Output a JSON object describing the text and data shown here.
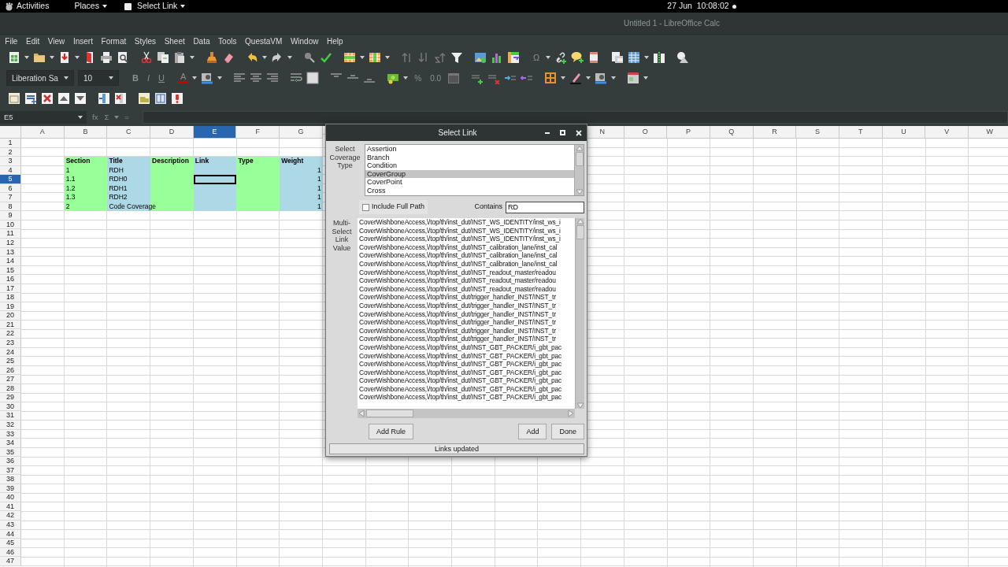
{
  "top_bar": {
    "activities": "Activities",
    "places": "Places",
    "app_menu": "Select Link",
    "clock": "27 Jun  10:08:02"
  },
  "window": {
    "title": "Untitled 1 - LibreOffice Calc"
  },
  "menu": [
    "File",
    "Edit",
    "View",
    "Insert",
    "Format",
    "Styles",
    "Sheet",
    "Data",
    "Tools",
    "QuestaVM",
    "Window",
    "Help"
  ],
  "toolbar": {
    "special_character": "Ω",
    "font_name": "Liberation Sa",
    "font_size": "10",
    "text_format_buttons": [
      "B",
      "I",
      "U"
    ],
    "font_color_button": "A",
    "number_format_buttons": [
      "%",
      "0.0"
    ]
  },
  "formula_bar": {
    "name_box": "E5",
    "function_buttons": [
      "fx",
      "Σ",
      "="
    ]
  },
  "sheet": {
    "columns": [
      {
        "label": "A",
        "selected": false
      },
      {
        "label": "B",
        "selected": false
      },
      {
        "label": "C",
        "selected": false
      },
      {
        "label": "D",
        "selected": false
      },
      {
        "label": "E",
        "selected": true
      },
      {
        "label": "F",
        "selected": false
      },
      {
        "label": "G",
        "selected": false
      },
      {
        "label": "N",
        "selected": false
      },
      {
        "label": "O",
        "selected": false
      },
      {
        "label": "P",
        "selected": false
      },
      {
        "label": "Q",
        "selected": false
      },
      {
        "label": "R",
        "selected": false
      },
      {
        "label": "S",
        "selected": false
      },
      {
        "label": "T",
        "selected": false
      },
      {
        "label": "U",
        "selected": false
      },
      {
        "label": "V",
        "selected": false
      },
      {
        "label": "W",
        "selected": false
      }
    ],
    "rows": [
      {
        "label": "1",
        "selected": false
      },
      {
        "label": "2",
        "selected": false
      },
      {
        "label": "3",
        "selected": false
      },
      {
        "label": "4",
        "selected": false
      },
      {
        "label": "5",
        "selected": true
      },
      {
        "label": "6",
        "selected": false
      },
      {
        "label": "7",
        "selected": false
      },
      {
        "label": "8",
        "selected": false
      },
      {
        "label": "9",
        "selected": false
      },
      {
        "label": "10",
        "selected": false
      },
      {
        "label": "11",
        "selected": false
      },
      {
        "label": "12",
        "selected": false
      },
      {
        "label": "13",
        "selected": false
      },
      {
        "label": "14",
        "selected": false
      },
      {
        "label": "15",
        "selected": false
      },
      {
        "label": "16",
        "selected": false
      },
      {
        "label": "17",
        "selected": false
      },
      {
        "label": "18",
        "selected": false
      },
      {
        "label": "19",
        "selected": false
      },
      {
        "label": "20",
        "selected": false
      },
      {
        "label": "21",
        "selected": false
      },
      {
        "label": "22",
        "selected": false
      },
      {
        "label": "23",
        "selected": false
      },
      {
        "label": "24",
        "selected": false
      },
      {
        "label": "25",
        "selected": false
      },
      {
        "label": "26",
        "selected": false
      },
      {
        "label": "27",
        "selected": false
      },
      {
        "label": "28",
        "selected": false
      },
      {
        "label": "29",
        "selected": false
      },
      {
        "label": "30",
        "selected": false
      },
      {
        "label": "31",
        "selected": false
      },
      {
        "label": "32",
        "selected": false
      },
      {
        "label": "33",
        "selected": false
      },
      {
        "label": "34",
        "selected": false
      },
      {
        "label": "35",
        "selected": false
      },
      {
        "label": "36",
        "selected": false
      },
      {
        "label": "37",
        "selected": false
      },
      {
        "label": "38",
        "selected": false
      },
      {
        "label": "39",
        "selected": false
      },
      {
        "label": "40",
        "selected": false
      },
      {
        "label": "41",
        "selected": false
      },
      {
        "label": "42",
        "selected": false
      },
      {
        "label": "43",
        "selected": false
      },
      {
        "label": "44",
        "selected": false
      },
      {
        "label": "45",
        "selected": false
      },
      {
        "label": "46",
        "selected": false
      },
      {
        "label": "47",
        "selected": false
      }
    ],
    "block": {
      "columns": [
        {
          "color": "#99ff99",
          "kind": "text",
          "cells": [
            "Section",
            "1",
            "1.1",
            "1.2",
            "1.3",
            "2"
          ]
        },
        {
          "color": "#add8e6",
          "kind": "text",
          "cells": [
            "Title",
            "RDH",
            "RDH0",
            "RDH1",
            "RDH2",
            "Code Coverage"
          ]
        },
        {
          "color": "#99ff99",
          "kind": "text",
          "cells": [
            "Description"
          ]
        },
        {
          "color": "#add8e6",
          "kind": "text",
          "cells": [
            "Link"
          ]
        },
        {
          "color": "#99ff99",
          "kind": "text",
          "cells": [
            "Type"
          ]
        },
        {
          "color": "#add8e6",
          "kind": "number",
          "cells": [
            "Weight",
            "1",
            "1",
            "1",
            "1",
            "1"
          ]
        }
      ]
    }
  },
  "dialog": {
    "title": "Select Link",
    "coverage_label": "Select Coverage Type",
    "coverage_types": [
      {
        "label": "Assertion",
        "selected": false
      },
      {
        "label": "Branch",
        "selected": false
      },
      {
        "label": "Condition",
        "selected": false
      },
      {
        "label": "CoverGroup",
        "selected": true
      },
      {
        "label": "CoverPoint",
        "selected": false
      },
      {
        "label": "Cross",
        "selected": false
      }
    ],
    "full_path": {
      "label": "Include Full Path",
      "checked": false
    },
    "contains": {
      "label": "Contains",
      "value": "RD"
    },
    "values_label": "Multi-Select Link Value",
    "link_values": [
      "CoverWishboneAccess,\\/top/th/inst_dut/INST_WS_IDENTITY/inst_ws_i",
      "CoverWishboneAccess,\\/top/th/inst_dut/INST_WS_IDENTITY/inst_ws_i",
      "CoverWishboneAccess,\\/top/th/inst_dut/INST_WS_IDENTITY/inst_ws_i",
      "CoverWishboneAccess,\\/top/th/inst_dut/INST_calibration_lane/inst_cal",
      "CoverWishboneAccess,\\/top/th/inst_dut/INST_calibration_lane/inst_cal",
      "CoverWishboneAccess,\\/top/th/inst_dut/INST_calibration_lane/inst_cal",
      "CoverWishboneAccess,\\/top/th/inst_dut/INST_readout_master/readou",
      "CoverWishboneAccess,\\/top/th/inst_dut/INST_readout_master/readou",
      "CoverWishboneAccess,\\/top/th/inst_dut/INST_readout_master/readou",
      "CoverWishboneAccess,\\/top/th/inst_dut/trigger_handler_INST/INST_tr",
      "CoverWishboneAccess,\\/top/th/inst_dut/trigger_handler_INST/INST_tr",
      "CoverWishboneAccess,\\/top/th/inst_dut/trigger_handler_INST/INST_tr",
      "CoverWishboneAccess,\\/top/th/inst_dut/trigger_handler_INST/INST_tr",
      "CoverWishboneAccess,\\/top/th/inst_dut/trigger_handler_INST/INST_tr",
      "CoverWishboneAccess,\\/top/th/inst_dut/trigger_handler_INST/INST_tr",
      "CoverWishboneAccess,\\/top/th/inst_dut/INST_GBT_PACKER/i_gbt_pac",
      "CoverWishboneAccess,\\/top/th/inst_dut/INST_GBT_PACKER/i_gbt_pac",
      "CoverWishboneAccess,\\/top/th/inst_dut/INST_GBT_PACKER/i_gbt_pac",
      "CoverWishboneAccess,\\/top/th/inst_dut/INST_GBT_PACKER/i_gbt_pac",
      "CoverWishboneAccess,\\/top/th/inst_dut/INST_GBT_PACKER/i_gbt_pac",
      "CoverWishboneAccess,\\/top/th/inst_dut/INST_GBT_PACKER/i_gbt_pac",
      "CoverWishboneAccess,\\/top/th/inst_dut/INST_GBT_PACKER/i_gbt_pac"
    ],
    "buttons": {
      "add_rule": "Add Rule",
      "add": "Add",
      "done": "Done"
    },
    "status": "Links updated"
  }
}
